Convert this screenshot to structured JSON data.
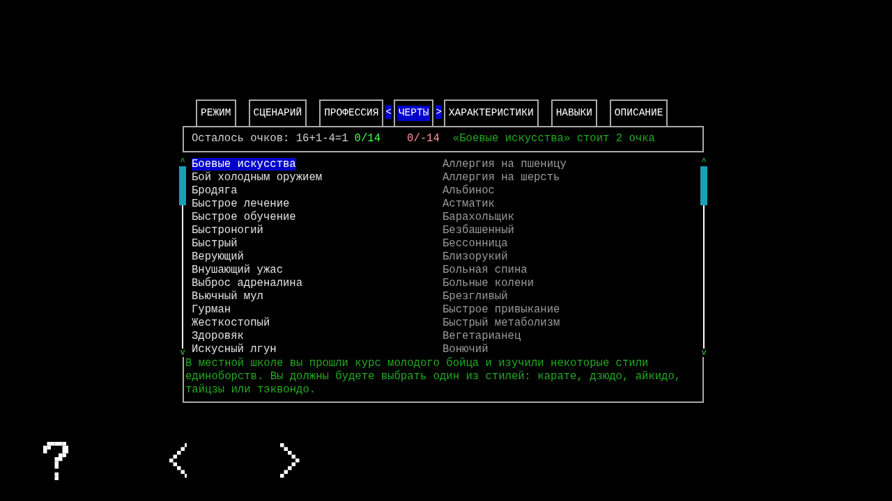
{
  "tabs": {
    "prev_marker": "<",
    "next_marker": ">",
    "items": [
      {
        "label": "РЕЖИМ",
        "selected": false
      },
      {
        "label": "СЦЕНАРИЙ",
        "selected": false
      },
      {
        "label": "ПРОФЕССИЯ",
        "selected": false
      },
      {
        "label": "ЧЕРТЫ",
        "selected": true
      },
      {
        "label": "ХАРАКТЕРИСТИКИ",
        "selected": false
      },
      {
        "label": "НАВЫКИ",
        "selected": false
      },
      {
        "label": "ОПИСАНИЕ",
        "selected": false
      }
    ]
  },
  "points": {
    "remaining": "Осталось очков: 16+1-4=1",
    "positive": "0/14",
    "negative": "0/-14",
    "cost": "«Боевые искусства» стоит 2 очка"
  },
  "scroll_bars": [
    {
      "up": "^",
      "down": "v"
    },
    {
      "up": "^",
      "down": "v"
    }
  ],
  "positive_traits": [
    {
      "label": "Боевые искусства",
      "selected": true
    },
    {
      "label": "Бой холодным оружием",
      "selected": false
    },
    {
      "label": "Бродяга",
      "selected": false
    },
    {
      "label": "Быстрое лечение",
      "selected": false
    },
    {
      "label": "Быстрое обучение",
      "selected": false
    },
    {
      "label": "Быстроногий",
      "selected": false
    },
    {
      "label": "Быстрый",
      "selected": false
    },
    {
      "label": "Верующий",
      "selected": false
    },
    {
      "label": "Внушающий ужас",
      "selected": false
    },
    {
      "label": "Выброс адреналина",
      "selected": false
    },
    {
      "label": "Вьючный мул",
      "selected": false
    },
    {
      "label": "Гурман",
      "selected": false
    },
    {
      "label": "Жесткостопый",
      "selected": false
    },
    {
      "label": "Здоровяк",
      "selected": false
    },
    {
      "label": "Искусный лгун",
      "selected": false
    }
  ],
  "negative_traits": [
    {
      "label": "Аллергия на пшеницу",
      "selected": false
    },
    {
      "label": "Аллергия на шерсть",
      "selected": false
    },
    {
      "label": "Альбинос",
      "selected": false
    },
    {
      "label": "Астматик",
      "selected": false
    },
    {
      "label": "Барахольщик",
      "selected": false
    },
    {
      "label": "Безбашенный",
      "selected": false
    },
    {
      "label": "Бессонница",
      "selected": false
    },
    {
      "label": "Близорукий",
      "selected": false
    },
    {
      "label": "Больная спина",
      "selected": false
    },
    {
      "label": "Больные колени",
      "selected": false
    },
    {
      "label": "Брезгливый",
      "selected": false
    },
    {
      "label": "Быстрое привыкание",
      "selected": false
    },
    {
      "label": "Быстрый метаболизм",
      "selected": false
    },
    {
      "label": "Вегетарианец",
      "selected": false
    },
    {
      "label": "Вонючий",
      "selected": false
    }
  ],
  "description": "В местной школе вы прошли курс молодого бойца и изучили некоторые стили единоборств. Вы должны будете выбрать один из стилей: карате, дзюдо, айкидо, тайцзы или тэквондо.",
  "bottom_buttons": [
    {
      "kind": "help"
    },
    {
      "kind": "prev"
    },
    {
      "kind": "next"
    }
  ]
}
